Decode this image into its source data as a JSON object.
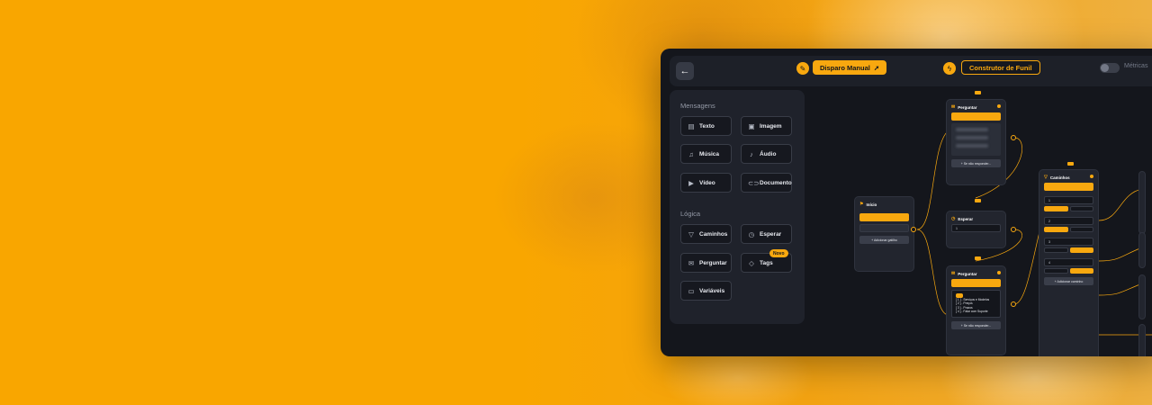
{
  "colors": {
    "accent": "#f8a80f",
    "app_bg": "#14161c",
    "panel_bg": "#1f222b",
    "page_bg": "#f9a600"
  },
  "toolbar": {
    "back_icon": "arrow-left-icon",
    "edit_icon": "pencil-icon",
    "primary_label": "Disparo Manual",
    "primary_icon": "rocket-icon",
    "bolt_icon": "lightning-icon",
    "builder_label": "Construtor de Funil",
    "metrics_label": "Métricas",
    "metrics_enabled": false
  },
  "sidebar": {
    "messages_title": "Mensagens",
    "messages": [
      {
        "label": "Texto",
        "icon": "text-message-icon"
      },
      {
        "label": "Imagem",
        "icon": "image-icon"
      },
      {
        "label": "Música",
        "icon": "music-icon"
      },
      {
        "label": "Áudio",
        "icon": "microphone-icon"
      },
      {
        "label": "Vídeo",
        "icon": "video-icon"
      },
      {
        "label": "Documento",
        "icon": "link-icon"
      }
    ],
    "logic_title": "Lógica",
    "logic": [
      {
        "label": "Caminhos",
        "icon": "filter-icon"
      },
      {
        "label": "Esperar",
        "icon": "clock-icon"
      },
      {
        "label": "Perguntar",
        "icon": "mail-open-icon"
      },
      {
        "label": "Tags",
        "icon": "tag-icon"
      },
      {
        "label": "Variáveis",
        "icon": "variable-icon"
      }
    ],
    "tags_badge": "Novo"
  },
  "canvas": {
    "inicio": {
      "title": "Início",
      "add": "+ Adicionar gatilho"
    },
    "perguntar1": {
      "title": "Perguntar",
      "add": "+ Se não responder..."
    },
    "esperar": {
      "title": "Esperar",
      "value": "1"
    },
    "perguntar2": {
      "title": "Perguntar",
      "msg_lines": [
        "[ 1 ] - Serviços e Modelos",
        "[ 2 ] - Preços",
        "[ 3 ] - Prazos",
        "[ 4 ] - Falar com Suporte"
      ],
      "add": "+ Se não responder..."
    },
    "caminhos": {
      "title": "Caminhos",
      "values": [
        "1",
        "2",
        "3",
        "4"
      ],
      "add": "+ Adicionar caminho"
    }
  }
}
